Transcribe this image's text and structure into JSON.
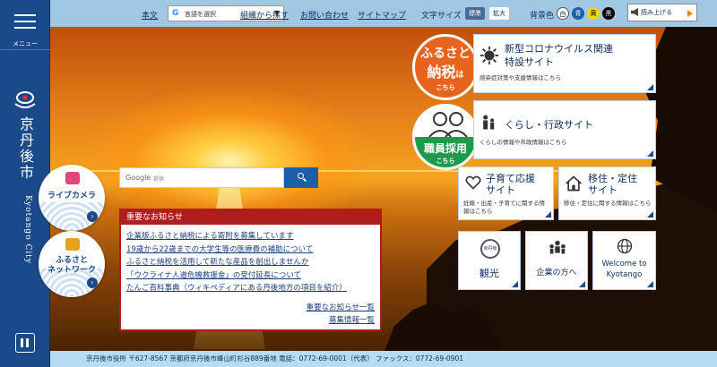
{
  "sidebar": {
    "menu_label": "メニュー",
    "city_name_jp": "京丹後市",
    "city_name_en": "Kyotango City"
  },
  "topbar": {
    "text_only": "本文",
    "lang_select": "言語を選択",
    "org_search": "組織から探す",
    "contact": "お問い合わせ",
    "sitemap": "サイトマップ",
    "font_size_label": "文字サイズ",
    "font_standard": "標準",
    "font_large": "拡大",
    "bg_color_label": "背景色",
    "bg_white": "白",
    "bg_blue": "青",
    "bg_yellow": "黄",
    "bg_black": "黒",
    "read_aloud": "読み上げる"
  },
  "badges": {
    "live_camera": "ライブカメラ",
    "furusato_network": "ふるさと\nネットワーク",
    "furusato_tax_l1": "ふるさと",
    "furusato_tax_l2": "納税",
    "furusato_tax_ha": "は",
    "furusato_tax_sub": "こちら",
    "recruit": "職員採用",
    "recruit_sub": "こちら"
  },
  "search": {
    "logo": "Google",
    "placeholder": "提供"
  },
  "notice": {
    "title": "重要なお知らせ",
    "items": [
      "企業版ふるさと納税による寄附を募集しています",
      "19歳から22歳までの大学生等の医療費の補助について",
      "ふるさと納税を活用して新たな産品を創出しませんか",
      "「ウクライナ人道危機救援金」の受付延長について",
      "たんご百科事典（ウィキペディアにある丹後地方の項目を紹介）"
    ],
    "more": "重要なお知らせ一覧",
    "recruit_list": "募集情報一覧"
  },
  "tiles": {
    "corona_title": "新型コロナウイルス関連\n特設サイト",
    "corona_sub": "感染症対策や支援情報はこちら",
    "life_title": "くらし・行政サイト",
    "life_sub": "くらしの情報や市政情報はこちら",
    "childcare_title": "子育て応援\nサイト",
    "childcare_sub": "妊娠・出産・子育てに関する情報はこちら",
    "migration_title": "移住・定住\nサイト",
    "migration_sub": "移住・定住に関する情報はこちら",
    "tourism_logo": "京丹後",
    "tourism": "観光",
    "business": "企業の方へ",
    "welcome": "Welcome to\nKyotango"
  },
  "footer": {
    "text": "京丹後市役所 〒627-8567 京都府京丹後市峰山町杉谷889番地 電話：0772-69-0001（代表） ファックス：0772-69-0901"
  }
}
